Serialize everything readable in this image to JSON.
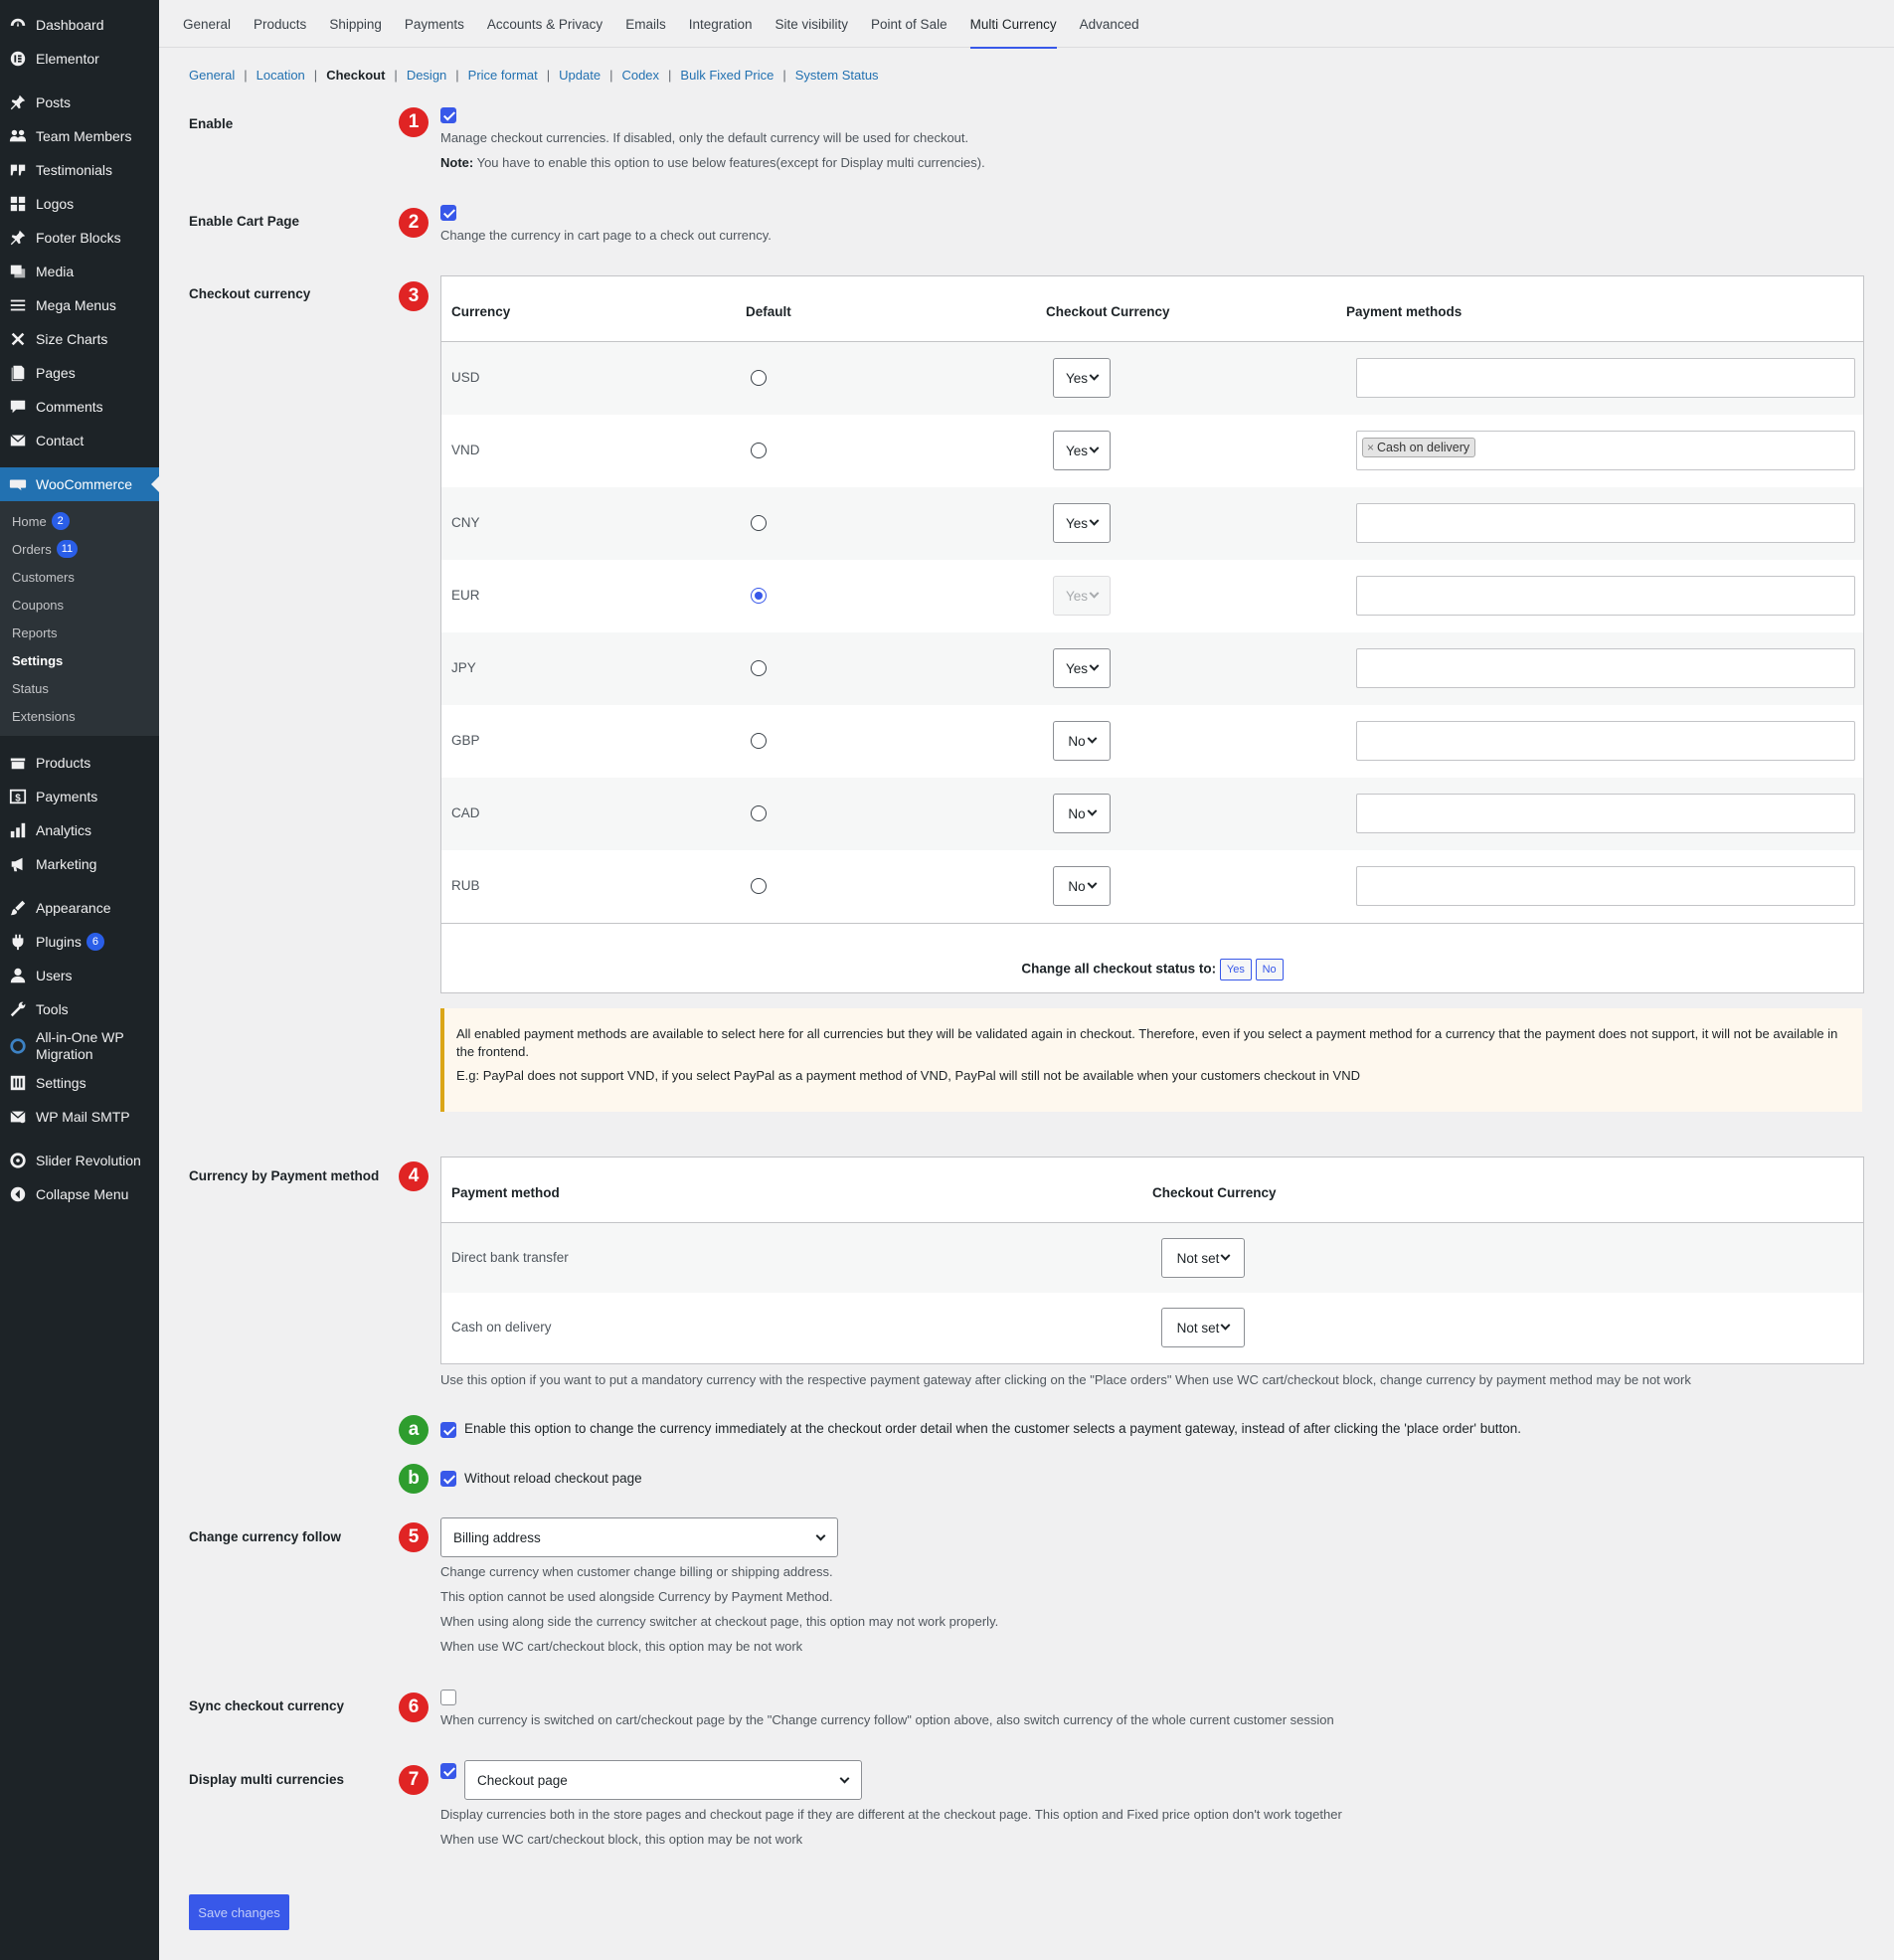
{
  "sidebar": {
    "top_items": [
      {
        "label": "Dashboard",
        "icon": "dashboard-icon"
      },
      {
        "label": "Elementor",
        "icon": "elementor-icon"
      }
    ],
    "content_items": [
      {
        "label": "Posts",
        "icon": "pin-icon"
      },
      {
        "label": "Team Members",
        "icon": "users-group-icon"
      },
      {
        "label": "Testimonials",
        "icon": "quote-icon"
      },
      {
        "label": "Logos",
        "icon": "grid-icon"
      },
      {
        "label": "Footer Blocks",
        "icon": "pin-icon"
      },
      {
        "label": "Media",
        "icon": "media-icon"
      },
      {
        "label": "Mega Menus",
        "icon": "menu-icon"
      },
      {
        "label": "Size Charts",
        "icon": "tools-cross-icon"
      },
      {
        "label": "Pages",
        "icon": "pages-icon"
      },
      {
        "label": "Comments",
        "icon": "comment-icon"
      },
      {
        "label": "Contact",
        "icon": "mail-icon"
      }
    ],
    "woocommerce": {
      "label": "WooCommerce",
      "icon": "woo-icon"
    },
    "woo_sub": [
      {
        "label": "Home",
        "badge": "2"
      },
      {
        "label": "Orders",
        "badge": "11"
      },
      {
        "label": "Customers"
      },
      {
        "label": "Coupons"
      },
      {
        "label": "Reports"
      },
      {
        "label": "Settings"
      },
      {
        "label": "Status"
      },
      {
        "label": "Extensions"
      }
    ],
    "shop_items": [
      {
        "label": "Products",
        "icon": "products-icon"
      },
      {
        "label": "Payments",
        "icon": "payments-icon"
      },
      {
        "label": "Analytics",
        "icon": "analytics-icon"
      },
      {
        "label": "Marketing",
        "icon": "megaphone-icon"
      }
    ],
    "admin_items": [
      {
        "label": "Appearance",
        "icon": "brush-icon"
      },
      {
        "label": "Plugins",
        "icon": "plugin-icon",
        "badge": "6"
      },
      {
        "label": "Users",
        "icon": "user-icon"
      },
      {
        "label": "Tools",
        "icon": "wrench-icon"
      },
      {
        "label": "All-in-One WP Migration",
        "icon": "migration-icon"
      },
      {
        "label": "Settings",
        "icon": "settings-icon"
      },
      {
        "label": "WP Mail SMTP",
        "icon": "mail-smtp-icon"
      }
    ],
    "bottom_items": [
      {
        "label": "Slider Revolution",
        "icon": "slider-icon"
      },
      {
        "label": "Collapse Menu",
        "icon": "collapse-icon"
      }
    ]
  },
  "tabs": [
    "General",
    "Products",
    "Shipping",
    "Payments",
    "Accounts & Privacy",
    "Emails",
    "Integration",
    "Site visibility",
    "Point of Sale",
    "Multi Currency",
    "Advanced"
  ],
  "active_tab": "Multi Currency",
  "subtabs": [
    "General",
    "Location",
    "Checkout",
    "Design",
    "Price format",
    "Update",
    "Codex",
    "Bulk Fixed Price",
    "System Status"
  ],
  "active_subtab": "Checkout",
  "enable": {
    "number": "1",
    "label": "Enable",
    "checked": true,
    "desc": "Manage checkout currencies. If disabled, only the default currency will be used for checkout.",
    "note_label": "Note:",
    "note": " You have to enable this option to use below features(except for Display multi currencies)."
  },
  "cart_page": {
    "number": "2",
    "label": "Enable Cart Page",
    "checked": true,
    "desc": "Change the currency in cart page to a check out currency."
  },
  "checkout_currency": {
    "number": "3",
    "label": "Checkout currency",
    "headers": {
      "currency": "Currency",
      "default": "Default",
      "checkout": "Checkout Currency",
      "payment": "Payment methods"
    },
    "rows": [
      {
        "code": "USD",
        "default": false,
        "checkout": "Yes",
        "disabled": false,
        "methods": []
      },
      {
        "code": "VND",
        "default": false,
        "checkout": "Yes",
        "disabled": false,
        "methods": [
          "Cash on delivery"
        ]
      },
      {
        "code": "CNY",
        "default": false,
        "checkout": "Yes",
        "disabled": false,
        "methods": []
      },
      {
        "code": "EUR",
        "default": true,
        "checkout": "Yes",
        "disabled": true,
        "methods": []
      },
      {
        "code": "JPY",
        "default": false,
        "checkout": "Yes",
        "disabled": false,
        "methods": []
      },
      {
        "code": "GBP",
        "default": false,
        "checkout": "No",
        "disabled": false,
        "methods": []
      },
      {
        "code": "CAD",
        "default": false,
        "checkout": "No",
        "disabled": false,
        "methods": []
      },
      {
        "code": "RUB",
        "default": false,
        "checkout": "No",
        "disabled": false,
        "methods": []
      }
    ],
    "change_all_label": "Change all checkout status to:",
    "yes_label": "Yes",
    "no_label": "No"
  },
  "notice": {
    "line1": "All enabled payment methods are available to select here for all currencies but they will be validated again in checkout. Therefore, even if you select a payment method for a currency that the payment does not support, it will not be available in the frontend.",
    "line2": "E.g: PayPal does not support VND, if you select PayPal as a payment method of VND, PayPal will still not be available when your customers checkout in VND"
  },
  "payment_method": {
    "number": "4",
    "label": "Currency by Payment method",
    "headers": {
      "method": "Payment method",
      "currency": "Checkout Currency"
    },
    "rows": [
      {
        "method": "Direct bank transfer",
        "currency": "Not set"
      },
      {
        "method": "Cash on delivery",
        "currency": "Not set"
      }
    ],
    "desc": "Use this option if you want to put a mandatory currency with the respective payment gateway after clicking on the \"Place orders\" When use WC cart/checkout block, change currency by payment method may be not work",
    "opt_a": {
      "marker": "a",
      "checked": true,
      "label": "Enable this option to change the currency immediately at the checkout order detail when the customer selects a payment gateway, instead of after clicking the 'place order' button."
    },
    "opt_b": {
      "marker": "b",
      "checked": true,
      "label": "Without reload checkout page"
    }
  },
  "currency_follow": {
    "number": "5",
    "label": "Change currency follow",
    "value": "Billing address",
    "desc": [
      "Change currency when customer change billing or shipping address.",
      "This option cannot be used alongside Currency by Payment Method.",
      "When using along side the currency switcher at checkout page, this option may not work properly.",
      "When use WC cart/checkout block, this option may be not work"
    ]
  },
  "sync": {
    "number": "6",
    "label": "Sync checkout currency",
    "checked": false,
    "desc": "When currency is switched on cart/checkout page by the \"Change currency follow\" option above, also switch currency of the whole current customer session"
  },
  "display_multi": {
    "number": "7",
    "label": "Display multi currencies",
    "checked": true,
    "value": "Checkout page",
    "desc": [
      "Display currencies both in the store pages and checkout page if they are different at the checkout page. This option and Fixed price option don't work together",
      "When use WC cart/checkout block, this option may be not work"
    ]
  },
  "save_label": "Save changes",
  "colors": {
    "accent": "#3858e9",
    "number_red": "#e02424",
    "number_green": "#2e9d2e",
    "sidebar": "#1d2327"
  }
}
